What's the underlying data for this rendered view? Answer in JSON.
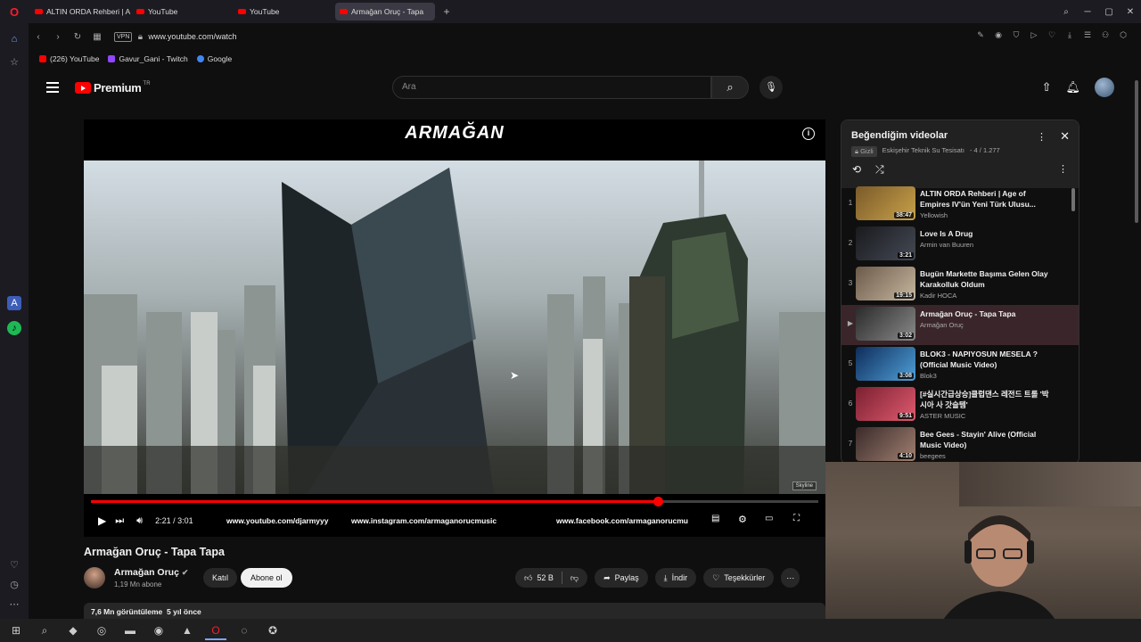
{
  "browser": {
    "tabs": [
      {
        "label": "ALTIN ORDA Rehberi | Age",
        "active": false
      },
      {
        "label": "YouTube",
        "active": false
      },
      {
        "label": "YouTube",
        "active": false
      },
      {
        "label": "Armağan Oruç - Tapa",
        "active": true
      }
    ],
    "new_tab": "+",
    "address": "www.youtube.com/watch",
    "vpn_label": "VPN",
    "bookmarks": [
      {
        "label": "(226) YouTube",
        "color": "#ff0000"
      },
      {
        "label": "Gavur_Gani - Twitch",
        "color": "#9146ff"
      },
      {
        "label": "Google",
        "color": "#4285f4"
      }
    ]
  },
  "youtube": {
    "logo_text": "Premium",
    "logo_region": "TR",
    "search_placeholder": "Ara"
  },
  "player": {
    "brand_text": "ARMAĞAN",
    "current_time": "2:21",
    "duration": "3:01",
    "time_separator": "/",
    "progress_fraction": 0.78,
    "overlay_urls": [
      "www.youtube.com/djarmyyy",
      "www.instagram.com/armaganorucmusic",
      "www.facebook.com/armaganorucmu"
    ],
    "watermark": "Skyline"
  },
  "video": {
    "title": "Armağan Oruç - Tapa Tapa",
    "channel": "Armağan Oruç",
    "subscribers": "1,19 Mn abone",
    "join_label": "Katıl",
    "subscribe_label": "Abone ol",
    "likes": "52 B",
    "share_label": "Paylaş",
    "download_label": "İndir",
    "thanks_label": "Teşekkürler",
    "views": "7,6 Mn görüntüleme",
    "age": "5 yıl önce"
  },
  "playlist": {
    "title": "Beğendiğim videolar",
    "privacy": "Gizli",
    "owner": "Eskişehir Teknik Su Tesisatı",
    "position": "- 4 / 1.277",
    "items": [
      {
        "index": "1",
        "title": "ALTIN ORDA Rehberi | Age of Empires IV'ün Yeni Türk Ulusu...",
        "channel": "Yellowish",
        "duration": "38:47",
        "colors": [
          "#7a5a2a",
          "#c9a24a"
        ]
      },
      {
        "index": "2",
        "title": "Love Is A Drug",
        "channel": "Armin van Buuren",
        "duration": "3:21",
        "colors": [
          "#1a1a1e",
          "#444a55"
        ]
      },
      {
        "index": "3",
        "title": "Bugün Markette Başıma Gelen Olay Karakolluk Oldum",
        "channel": "Kadir HOCA",
        "duration": "19:15",
        "colors": [
          "#6b5a4a",
          "#c7b79f"
        ]
      },
      {
        "index": "▶",
        "title": "Armağan Oruç - Tapa Tapa",
        "channel": "Armağan Oruç",
        "duration": "3:02",
        "colors": [
          "#2a2a2a",
          "#8a8a8a"
        ]
      },
      {
        "index": "5",
        "title": "BLOK3 - NAPIYOSUN MESELA ? (Official Music Video)",
        "channel": "Blok3",
        "duration": "3:08",
        "colors": [
          "#0e2c5a",
          "#4fa0d8"
        ]
      },
      {
        "index": "6",
        "title": "[#실시간급상승]클럽댄스 레전드 트롤 '박시아 사 갓슬템'",
        "channel": "ASTER MUSIC",
        "duration": "9:51",
        "colors": [
          "#7a2030",
          "#e05a70"
        ]
      },
      {
        "index": "7",
        "title": "Bee Gees - Stayin' Alive (Official Music Video)",
        "channel": "beegees",
        "duration": "4:10",
        "colors": [
          "#3a2a2a",
          "#a08070"
        ]
      }
    ]
  },
  "colors": {
    "accent_red": "#ff0000",
    "background": "#0f0f0f",
    "chip": "#272727"
  }
}
